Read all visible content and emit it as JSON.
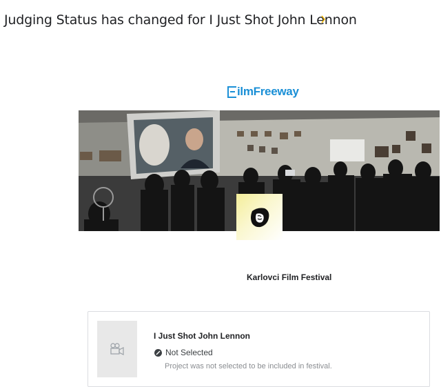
{
  "email": {
    "subject": "Judging Status has changed for I Just Shot John Lennon",
    "importance_marker": "›"
  },
  "brand": {
    "logo_text": "ilmFreeway",
    "logo_color": "#1a8fd6"
  },
  "festival": {
    "name": "Karlovci Film Festival"
  },
  "submission": {
    "project_title": "I Just Shot John Lennon",
    "status_label": "Not Selected",
    "status_description": "Project was not selected to be included in festival."
  },
  "icons": {
    "importance": "importance-marker-icon",
    "thumbnail": "video-camera-icon",
    "status": "not-selected-icon"
  }
}
